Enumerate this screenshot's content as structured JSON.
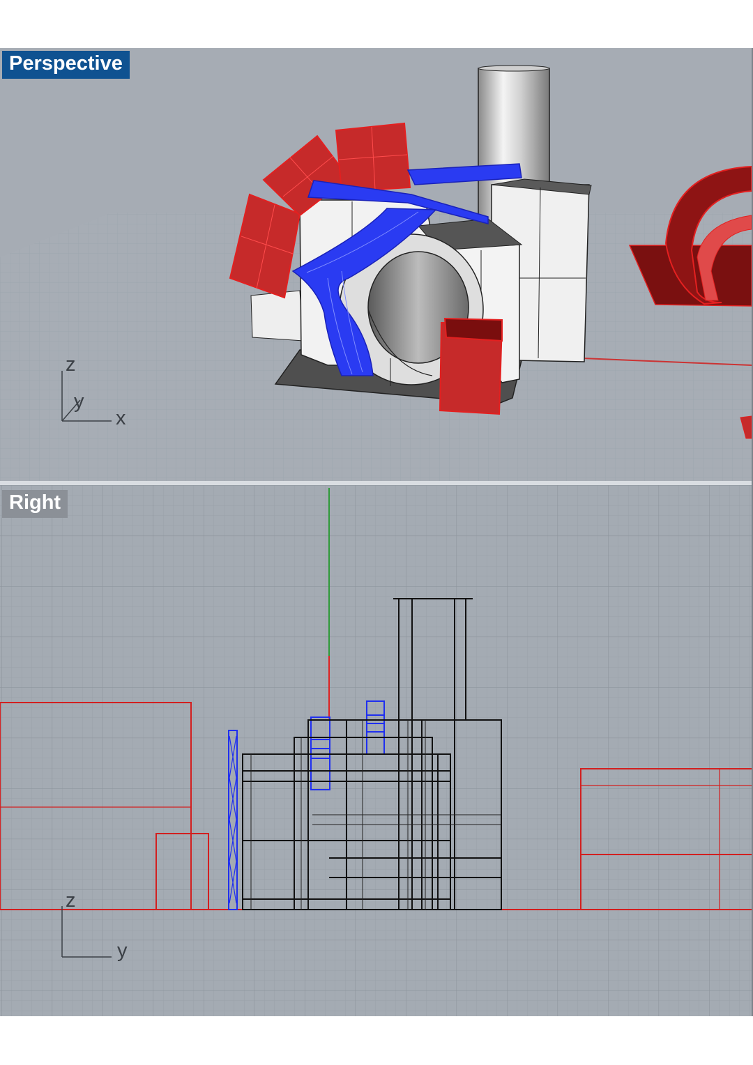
{
  "viewports": {
    "perspective": {
      "label": "Perspective",
      "active": true,
      "axes": {
        "z": "z",
        "y": "y",
        "x": "x"
      }
    },
    "right": {
      "label": "Right",
      "active": false,
      "axes": {
        "z": "z",
        "y": "y"
      }
    }
  },
  "colors": {
    "active_label_bg": "#0f5291",
    "inactive_label_bg": "#8b9097",
    "viewport_bg": "#a6acb4",
    "selected_red": "#d21f1f",
    "selected_blue": "#1f2ff0",
    "object_white": "#f0f0f0",
    "grid_line": "#979da5"
  },
  "icons": [
    "perspective-axis-gizmo-icon",
    "right-axis-gizmo-icon"
  ]
}
